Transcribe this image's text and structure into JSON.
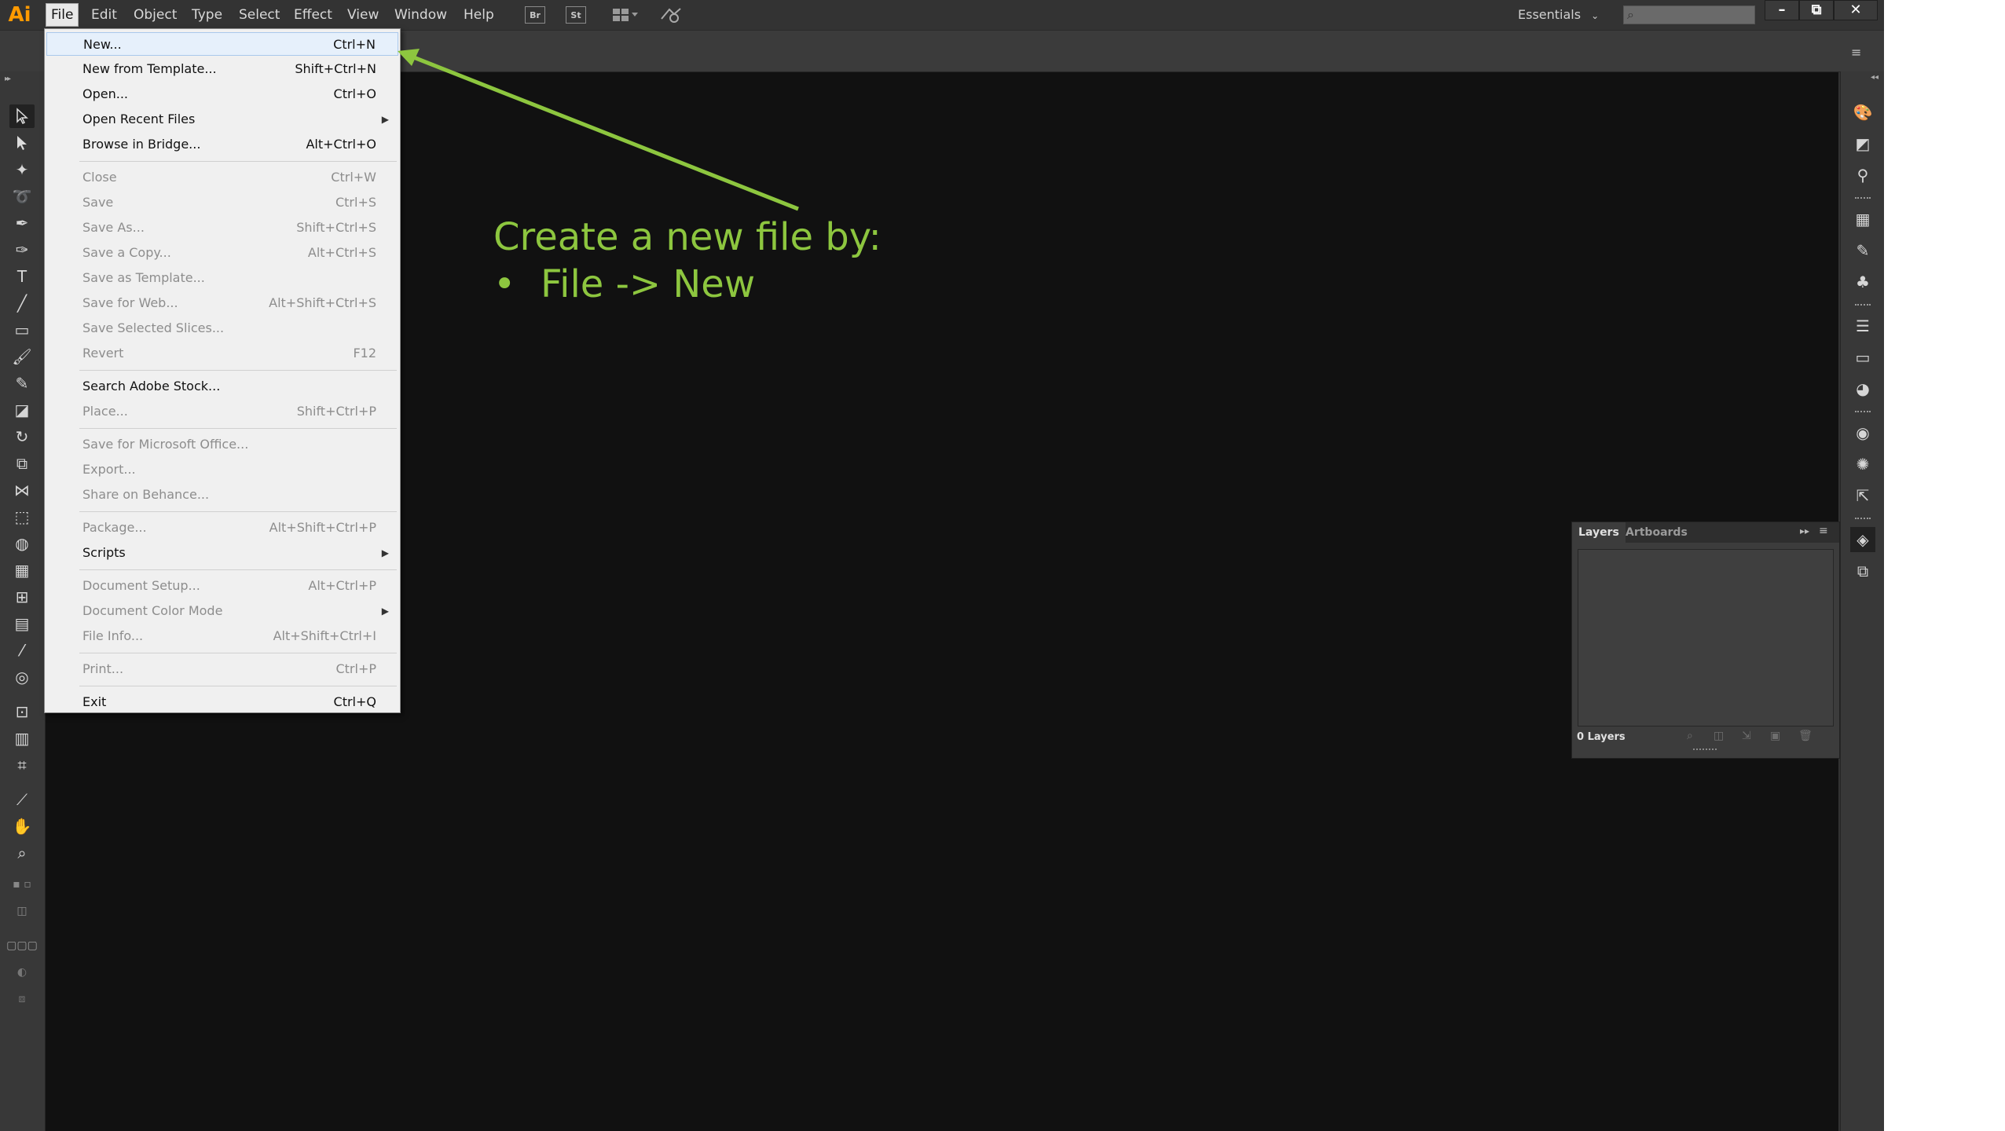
{
  "app": {
    "logo": "Ai"
  },
  "menubar": {
    "items": [
      "File",
      "Edit",
      "Object",
      "Type",
      "Select",
      "Effect",
      "View",
      "Window",
      "Help"
    ],
    "bridge_label": "Br",
    "stock_label": "St",
    "workspace": "Essentials",
    "workspace_arrow": "⌄",
    "minimize": "–",
    "restore": "⧉",
    "close": "✕"
  },
  "file_menu": [
    {
      "label": "New...",
      "shortcut": "Ctrl+N",
      "enabled": true,
      "highlighted": true
    },
    {
      "label": "New from Template...",
      "shortcut": "Shift+Ctrl+N",
      "enabled": true
    },
    {
      "label": "Open...",
      "shortcut": "Ctrl+O",
      "enabled": true
    },
    {
      "label": "Open Recent Files",
      "shortcut": "",
      "enabled": true,
      "submenu": true
    },
    {
      "label": "Browse in Bridge...",
      "shortcut": "Alt+Ctrl+O",
      "enabled": true
    },
    {
      "label": "Close",
      "shortcut": "Ctrl+W",
      "enabled": false,
      "sep_before": true
    },
    {
      "label": "Save",
      "shortcut": "Ctrl+S",
      "enabled": false
    },
    {
      "label": "Save As...",
      "shortcut": "Shift+Ctrl+S",
      "enabled": false
    },
    {
      "label": "Save a Copy...",
      "shortcut": "Alt+Ctrl+S",
      "enabled": false
    },
    {
      "label": "Save as Template...",
      "shortcut": "",
      "enabled": false
    },
    {
      "label": "Save for Web...",
      "shortcut": "Alt+Shift+Ctrl+S",
      "enabled": false
    },
    {
      "label": "Save Selected Slices...",
      "shortcut": "",
      "enabled": false
    },
    {
      "label": "Revert",
      "shortcut": "F12",
      "enabled": false
    },
    {
      "label": "Search Adobe Stock...",
      "shortcut": "",
      "enabled": true,
      "sep_before": true
    },
    {
      "label": "Place...",
      "shortcut": "Shift+Ctrl+P",
      "enabled": false
    },
    {
      "label": "Save for Microsoft Office...",
      "shortcut": "",
      "enabled": false,
      "sep_before": true
    },
    {
      "label": "Export...",
      "shortcut": "",
      "enabled": false
    },
    {
      "label": "Share on Behance...",
      "shortcut": "",
      "enabled": false
    },
    {
      "label": "Package...",
      "shortcut": "Alt+Shift+Ctrl+P",
      "enabled": false,
      "sep_before": true
    },
    {
      "label": "Scripts",
      "shortcut": "",
      "enabled": true,
      "submenu": true
    },
    {
      "label": "Document Setup...",
      "shortcut": "Alt+Ctrl+P",
      "enabled": false,
      "sep_before": true
    },
    {
      "label": "Document Color Mode",
      "shortcut": "",
      "enabled": false,
      "submenu": true
    },
    {
      "label": "File Info...",
      "shortcut": "Alt+Shift+Ctrl+I",
      "enabled": false
    },
    {
      "label": "Print...",
      "shortcut": "Ctrl+P",
      "enabled": false,
      "sep_before": true
    },
    {
      "label": "Exit",
      "shortcut": "Ctrl+Q",
      "enabled": true,
      "sep_before": true
    }
  ],
  "annotation": {
    "line1": "Create a new file by:",
    "bullet": "•",
    "line2": "File -> New",
    "color": "#8dc63f"
  },
  "layers_panel": {
    "tabs": [
      "Layers",
      "Artboards"
    ],
    "count": "0 Layers"
  },
  "colors": {
    "canvas": "#111111",
    "chrome": "#323232",
    "accent_logo": "#ff9a00"
  }
}
